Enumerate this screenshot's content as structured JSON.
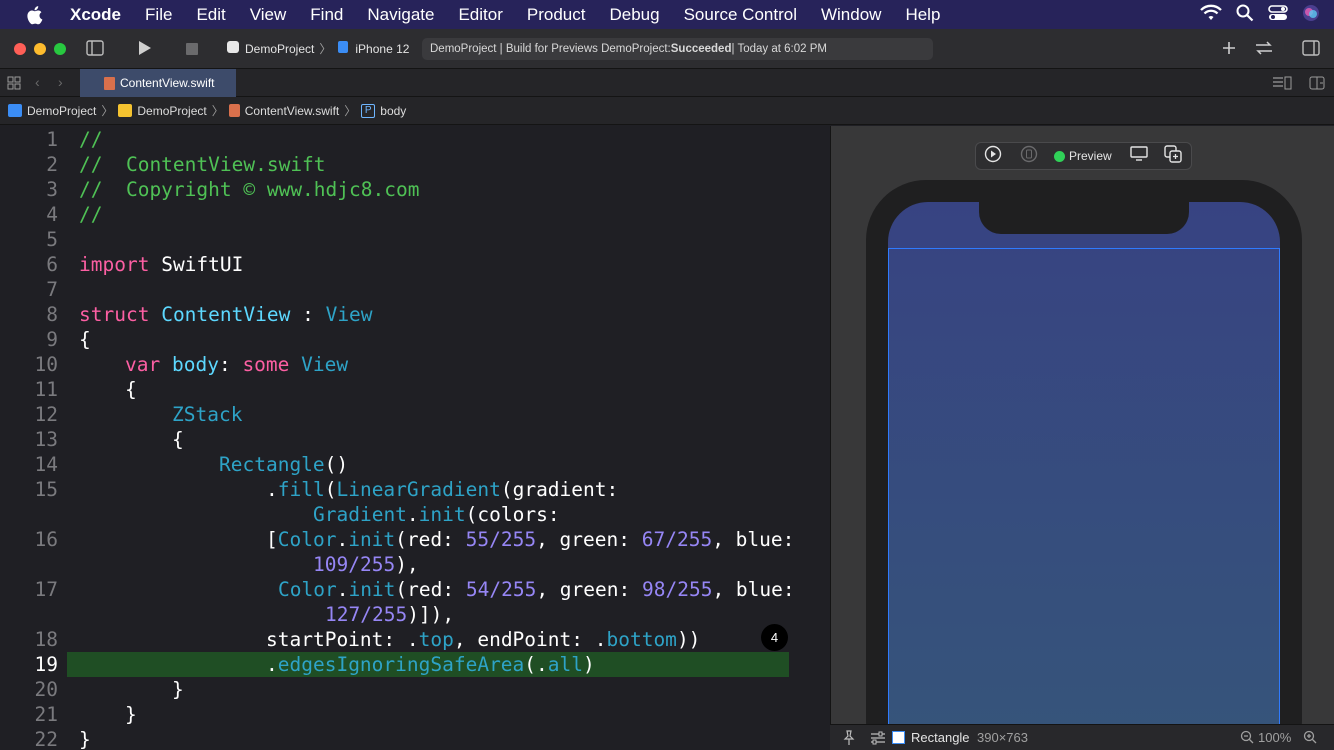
{
  "menubar": {
    "app": "Xcode",
    "items": [
      "File",
      "Edit",
      "View",
      "Find",
      "Navigate",
      "Editor",
      "Product",
      "Debug",
      "Source Control",
      "Window",
      "Help"
    ]
  },
  "toolbar": {
    "project": "DemoProject",
    "device": "iPhone 12",
    "activity": {
      "prefix": "DemoProject | Build for Previews DemoProject: ",
      "result": "Succeeded",
      "time": " | Today at 6:02 PM"
    }
  },
  "tab": {
    "file": "ContentView.swift"
  },
  "jumpbar": {
    "project": "DemoProject",
    "folder": "DemoProject",
    "file": "ContentView.swift",
    "symbol_badge": "P",
    "symbol": "body"
  },
  "code": {
    "ln": [
      "1",
      "2",
      "3",
      "4",
      "5",
      "6",
      "7",
      "8",
      "9",
      "10",
      "11",
      "12",
      "13",
      "14",
      "15",
      "16",
      "17",
      "18",
      "19",
      "20",
      "21",
      "22"
    ],
    "l1": "//",
    "l2": "//  ContentView.swift",
    "l3": "//  Copyright © www.hdjc8.com",
    "l4": "//",
    "l6": {
      "kw": "import",
      "sp": " ",
      "name": "SwiftUI"
    },
    "l8": {
      "kw": "struct",
      "sp": " ",
      "name": "ContentView",
      "colon": " : ",
      "proto": "View"
    },
    "l9": "{",
    "l10": {
      "kw": "var",
      "sp": " ",
      "name": "body",
      "colon": ": ",
      "kw2": "some",
      "sp2": " ",
      "type": "View"
    },
    "l11": "{",
    "l12": "ZStack",
    "l13": "{",
    "l14": {
      "type": "Rectangle",
      "paren": "()"
    },
    "l15a": {
      "dot": ".",
      "fn": "fill",
      "op": "(",
      "type": "LinearGradient",
      "rest": "(gradient:"
    },
    "l15b": {
      "type": "Gradient",
      "dot": ".",
      "fn": "init",
      "rest": "(colors:"
    },
    "l16a": {
      "br": "[",
      "type": "Color",
      "dot": ".",
      "fn": "init",
      "r": "(red: ",
      "rv": "55/255",
      "g": ", green: ",
      "gv": "67/255",
      "b": ", blue:"
    },
    "l16b": {
      "bv": "109/255",
      "end": "),"
    },
    "l17a": {
      "type": "Color",
      "dot": ".",
      "fn": "init",
      "r": "(red: ",
      "rv": "54/255",
      "g": ", green: ",
      "gv": "98/255",
      "b": ", blue:"
    },
    "l17b": {
      "bv": "127/255",
      "end": ")]),"
    },
    "l18": {
      "a": "startPoint: .",
      "top": "top",
      "b": ", endPoint: .",
      "bottom": "bottom",
      "c": "))"
    },
    "l19": {
      "dot": ".",
      "fn": "edgesIgnoringSafeArea",
      "a": "(.",
      "all": "all",
      "c": ")"
    },
    "l20": "}",
    "l21": "}",
    "l22": "}",
    "badge": "4",
    "current_line": "19"
  },
  "preview": {
    "label": "Preview",
    "selection": "Rectangle",
    "size": "390×763",
    "zoom": "100%"
  },
  "colors": {
    "comment": "#4fc155",
    "keyword": "#fc5fa3",
    "type": "#5dd8ff",
    "number": "#9686f5",
    "highlight": "#1f4e24",
    "gradient_top": "#374382",
    "gradient_bottom": "#36557a"
  }
}
